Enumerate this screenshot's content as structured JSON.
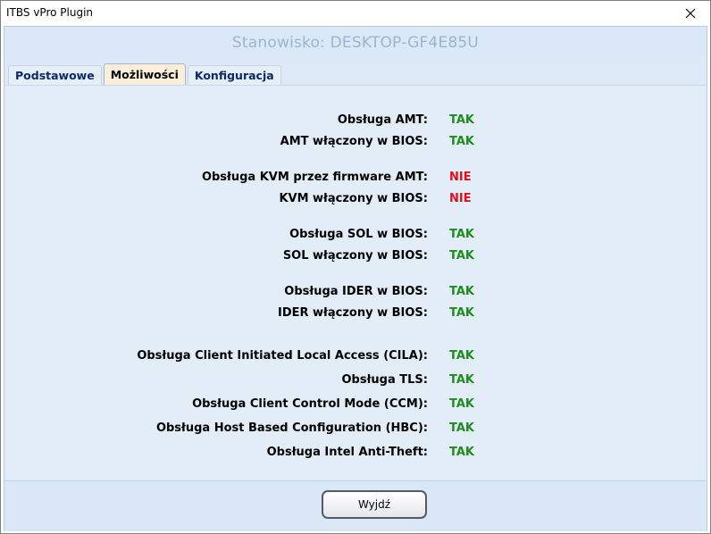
{
  "window": {
    "title": "ITBS vPro Plugin"
  },
  "header": {
    "station_title": "Stanowisko: DESKTOP-GF4E85U"
  },
  "tabs": [
    {
      "label": "Podstawowe",
      "active": false
    },
    {
      "label": "Możliwości",
      "active": true
    },
    {
      "label": "Konfiguracja",
      "active": false
    }
  ],
  "rows": [
    {
      "label": "Obsługa AMT:",
      "value": "TAK"
    },
    {
      "label": "AMT włączony w BIOS:",
      "value": "TAK"
    },
    {
      "label": "Obsługa KVM przez firmware AMT:",
      "value": "NIE"
    },
    {
      "label": "KVM włączony w BIOS:",
      "value": "NIE"
    },
    {
      "label": "Obsługa SOL w BIOS:",
      "value": "TAK"
    },
    {
      "label": "SOL włączony w BIOS:",
      "value": "TAK"
    },
    {
      "label": "Obsługa IDER w BIOS:",
      "value": "TAK"
    },
    {
      "label": "IDER włączony w BIOS:",
      "value": "TAK"
    },
    {
      "label": "Obsługa Client Initiated Local Access (CILA):",
      "value": "TAK"
    },
    {
      "label": "Obsługa TLS:",
      "value": "TAK"
    },
    {
      "label": "Obsługa Client Control Mode (CCM):",
      "value": "TAK"
    },
    {
      "label": "Obsługa Host Based Configuration (HBC):",
      "value": "TAK"
    },
    {
      "label": "Obsługa Intel Anti-Theft:",
      "value": "TAK"
    }
  ],
  "footer": {
    "exit_label": "Wyjdź"
  },
  "colors": {
    "yes": "#1e8c1e",
    "no": "#e0101a",
    "active_tab": "#fcefd9"
  },
  "icons": {
    "close": "close-icon"
  }
}
